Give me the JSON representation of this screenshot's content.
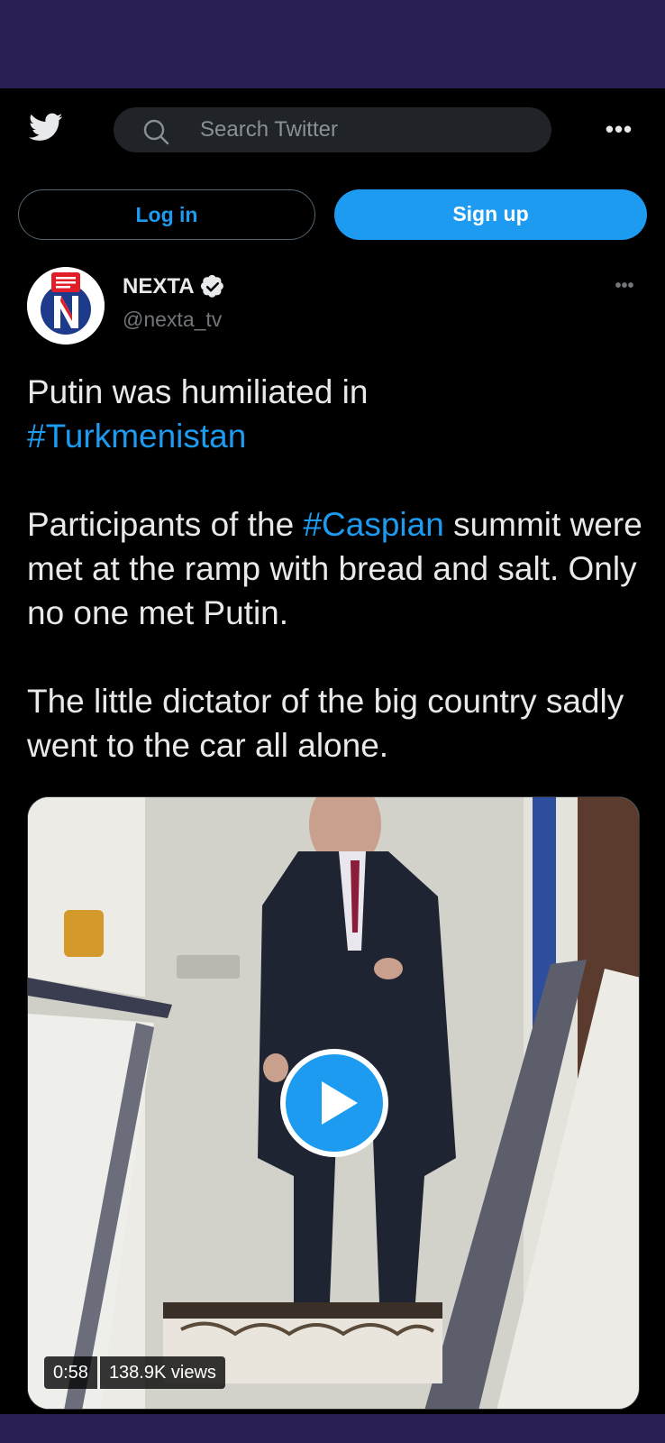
{
  "topnav": {
    "search_placeholder": "Search Twitter",
    "more_label": "•••"
  },
  "auth": {
    "login_label": "Log in",
    "signup_label": "Sign up"
  },
  "tweet": {
    "author_name": "NEXTA",
    "author_handle": "@nexta_tv",
    "more_label": "•••",
    "text": {
      "line1": "Putin was humiliated in",
      "hashtag1": "#Turkmenistan",
      "p2_before": "Participants of the ",
      "hashtag2": "#Caspian",
      "p2_after": " summit were met at the ramp with bread and salt. Only no one met Putin.",
      "p3": "The little dictator of the big country sadly went to the car all alone."
    },
    "video": {
      "duration": "0:58",
      "views": "138.9K views"
    }
  },
  "colors": {
    "accent": "#1d9bf0",
    "background": "#000000",
    "status_bar": "#2a1f55"
  },
  "icons": {
    "logo": "twitter-bird-icon",
    "search": "search-icon",
    "verified": "verified-badge-icon",
    "play": "play-icon"
  }
}
